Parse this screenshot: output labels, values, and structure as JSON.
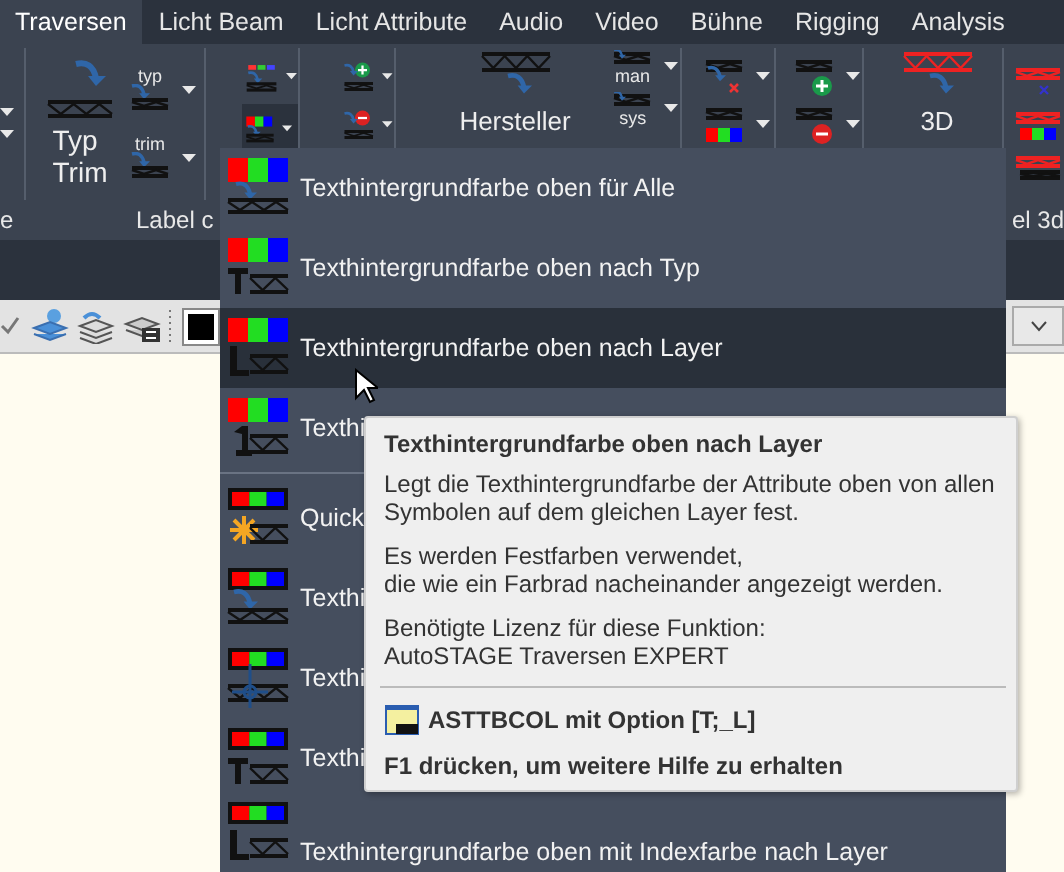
{
  "tabs": [
    {
      "label": "Traversen",
      "selected": true
    },
    {
      "label": "Licht Beam",
      "selected": false
    },
    {
      "label": "Licht Attribute",
      "selected": false
    },
    {
      "label": "Audio",
      "selected": false
    },
    {
      "label": "Video",
      "selected": false
    },
    {
      "label": "Bühne",
      "selected": false
    },
    {
      "label": "Rigging",
      "selected": false
    },
    {
      "label": "Analysis",
      "selected": false
    }
  ],
  "ribbon": {
    "typ_button": "typ",
    "trim_button": "trim",
    "typ_trim_button": [
      "Typ",
      "Trim"
    ],
    "color_button": {
      "expanded": true
    },
    "man_button": "man",
    "sys_button": "sys",
    "hersteller_button": "Hersteller",
    "three_d_button": "3D",
    "panel_labels": [
      "e",
      "Label c",
      "el 3d"
    ]
  },
  "menu": {
    "sections": [
      [
        {
          "label": "Texthintergrundfarbe oben für Alle",
          "hovered": false
        },
        {
          "label": "Texthintergrundfarbe oben nach Typ",
          "hovered": false
        },
        {
          "label": "Texthintergrundfarbe oben nach Layer",
          "hovered": true
        },
        {
          "label": "Texthi",
          "hovered": false
        }
      ],
      [
        {
          "label": "Quick",
          "hovered": false
        },
        {
          "label": "Texthi",
          "hovered": false
        },
        {
          "label": "Texthi",
          "hovered": false
        },
        {
          "label": "Texthi",
          "hovered": false
        },
        {
          "label": "Texthintergrundfarbe oben mit Indexfarbe nach Layer",
          "hovered": false
        }
      ]
    ]
  },
  "tooltip": {
    "title": "Texthintergrundfarbe oben nach Layer",
    "paragraphs": [
      "Legt die Texthintergrundfarbe der Attribute oben von allen\nSymbolen auf dem gleichen Layer fest.",
      "Es werden Festfarben verwendet,\ndie wie ein Farbrad nacheinander angezeigt werden.",
      "Benötigte Lizenz für diese Funktion:\nAutoSTAGE Traversen EXPERT"
    ],
    "command": "ASTTBCOL mit Option [T;_L]",
    "help": "F1 drücken, um weitere Hilfe zu erhalten"
  }
}
